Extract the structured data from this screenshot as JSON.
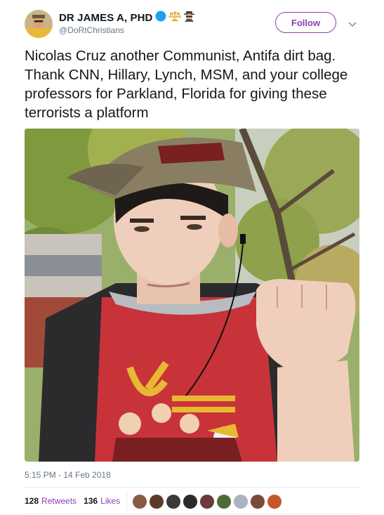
{
  "tweet": {
    "display_name": "DR JAMES A, PHD",
    "handle": "@DoRtChristians",
    "follow_label": "Follow",
    "text": "Nicolas Cruz another Communist, Antifa dirt bag. Thank CNN, Hillary, Lynch, MSM, and your college professors for Parkland, Florida for giving these terrorists a platform",
    "timestamp": "5:15 PM - 14 Feb 2018",
    "retweets_count": "128",
    "retweets_label": "Retweets",
    "likes_count": "136",
    "likes_label": "Likes"
  },
  "icons": {
    "verified": "verified-badge-icon",
    "scales": "scales-icon",
    "spy": "spy-icon",
    "caret": "chevron-down-icon"
  },
  "colors": {
    "accent": "#8b3fb0",
    "verified": "#1da1f2",
    "muted": "#657786"
  },
  "liker_avatars": [
    "#8a5a44",
    "#5c3b2a",
    "#3a3a3a",
    "#2a2a2a",
    "#6b3a3a",
    "#4f6b3a",
    "#a9b4bf",
    "#7a4a3a",
    "#c4562a"
  ]
}
